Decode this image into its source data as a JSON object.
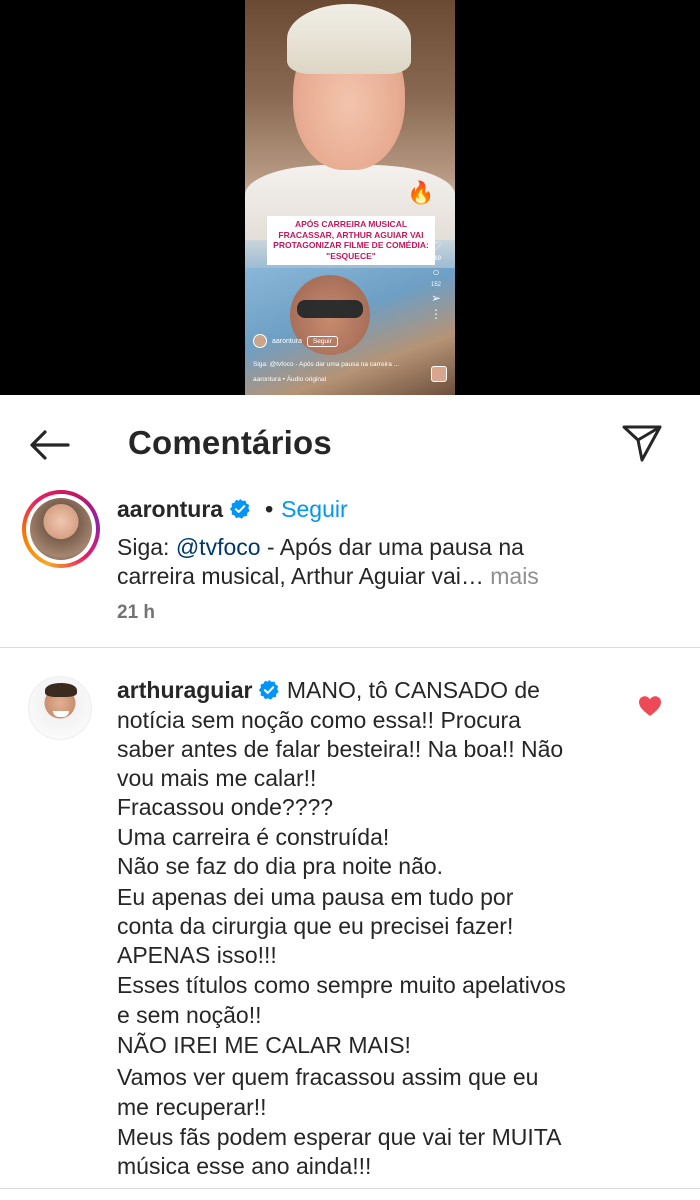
{
  "video": {
    "headline": "APÓS CARREIRA MUSICAL FRACASSAR, ARTHUR AGUIAR VAI PROTAGONIZAR FILME DE COMÉDIA: \"ESQUECE\"",
    "likes": "869",
    "comments": "152",
    "username": "aarontura",
    "follow_label": "Seguir",
    "caption": "Siga: @tvfoco - Após dar uma pausa na carreira ...",
    "audio": "aarontura • Áudio original"
  },
  "header": {
    "title": "Comentários"
  },
  "post": {
    "username": "aarontura",
    "separator": "•",
    "follow_label": "Seguir",
    "caption_prefix": "Siga: ",
    "mention": "@tvfoco",
    "caption_line1": " - Após dar uma pausa na",
    "caption_line2": "carreira musical, Arthur Aguiar vai…",
    "more_label": " mais",
    "time": "21 h"
  },
  "comment": {
    "username": "arthuraguiar",
    "lines": [
      "MANO, tô CANSADO de",
      "notícia sem noção como essa!! Procura",
      "saber antes de falar besteira!! Na boa!! Não",
      "vou mais me calar!!",
      "Fracassou onde????",
      "Uma carreira é construída!",
      "Não se faz do dia pra noite não.",
      "Eu apenas dei uma pausa em tudo por",
      "conta da cirurgia que eu precisei fazer!",
      "APENAS isso!!!",
      "Esses títulos como sempre muito apelativos",
      "e sem noção!!",
      "NÃO IREI ME CALAR MAIS!",
      "Vamos ver quem fracassou assim que eu",
      "me recuperar!!",
      "Meus fãs podem esperar que vai ter MUITA",
      "música esse ano ainda!!!"
    ],
    "liked": true
  },
  "colors": {
    "link_blue": "#0095f6",
    "mention_blue": "#00376b",
    "heart_red": "#ed4956",
    "verified_blue": "#0095f6",
    "text": "#262626",
    "muted": "#737373"
  },
  "icons": {
    "back": "arrow-left-icon",
    "share": "paper-plane-icon",
    "verified": "verified-badge-icon",
    "like": "heart-filled-icon"
  }
}
